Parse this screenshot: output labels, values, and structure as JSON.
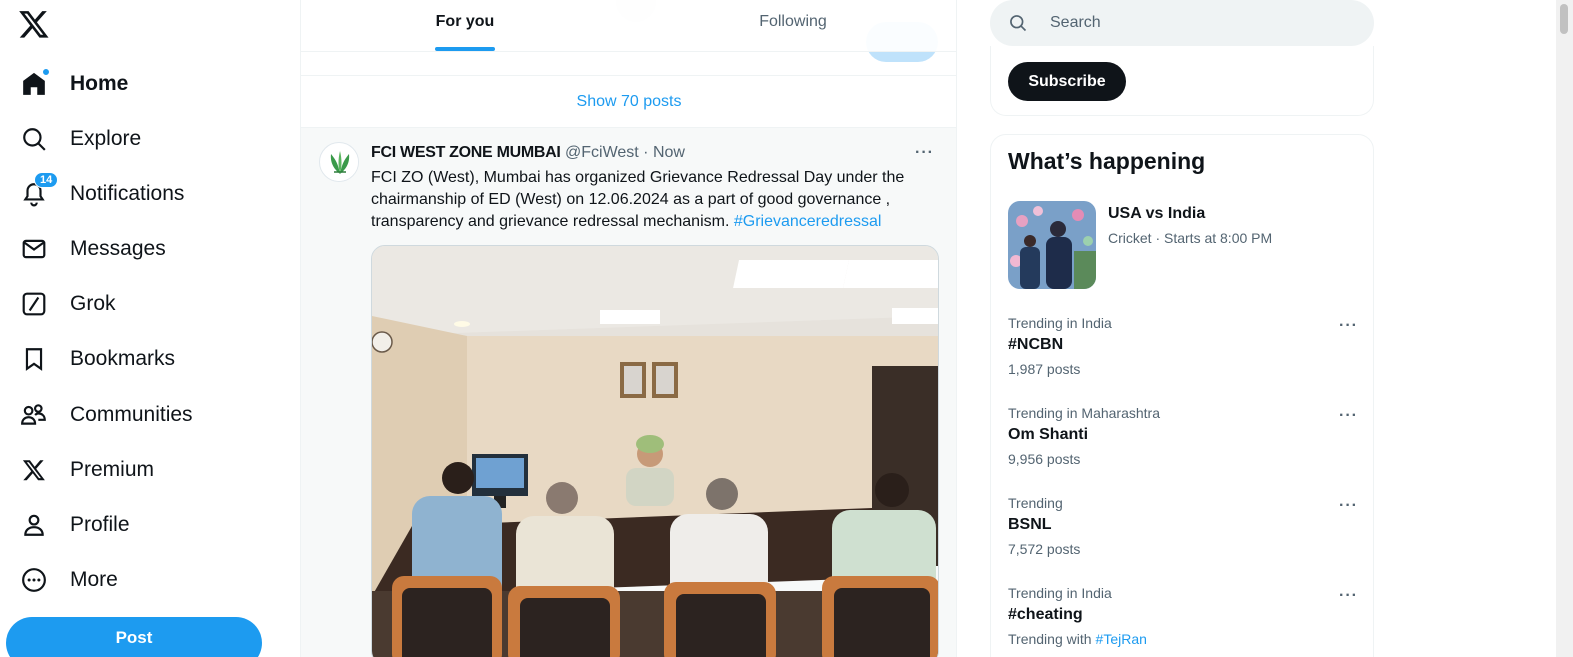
{
  "nav": {
    "items": [
      {
        "label": "Home",
        "icon": "home-icon"
      },
      {
        "label": "Explore",
        "icon": "search-icon"
      },
      {
        "label": "Notifications",
        "icon": "bell-icon",
        "badge": "14"
      },
      {
        "label": "Messages",
        "icon": "mail-icon"
      },
      {
        "label": "Grok",
        "icon": "grok-icon"
      },
      {
        "label": "Bookmarks",
        "icon": "bookmark-icon"
      },
      {
        "label": "Communities",
        "icon": "communities-icon"
      },
      {
        "label": "Premium",
        "icon": "x-logo-icon"
      },
      {
        "label": "Profile",
        "icon": "person-icon"
      },
      {
        "label": "More",
        "icon": "more-circle-icon"
      }
    ],
    "post_label": "Post"
  },
  "tabs": [
    {
      "label": "For you"
    },
    {
      "label": "Following"
    }
  ],
  "feed": {
    "show_posts": "Show 70 posts"
  },
  "tweet": {
    "name": "FCI WEST ZONE MUMBAI",
    "handle": "@FciWest",
    "separator": " · ",
    "time": "Now",
    "text": "FCI ZO (West), Mumbai has organized Grievance Redressal Day under the chairmanship of ED (West) on 12.06.2024 as a part of good governance , transparency and grievance redressal mechanism. ",
    "hashtag": "#Grievanceredressal"
  },
  "search": {
    "placeholder": "Search"
  },
  "subscribe_label": "Subscribe",
  "happening": {
    "title": "What’s happening",
    "featured": {
      "title": "USA vs India",
      "subtitle": "Cricket · Starts at 8:00 PM"
    },
    "trends": [
      {
        "context": "Trending in India",
        "name": "#NCBN",
        "count": "1,987 posts"
      },
      {
        "context": "Trending in Maharashtra",
        "name": "Om Shanti",
        "count": "9,956 posts"
      },
      {
        "context": "Trending",
        "name": "BSNL",
        "count": "7,572 posts"
      },
      {
        "context": "Trending in India",
        "name": "#cheating",
        "count": "Trending with",
        "with_tag": "#TejRan"
      }
    ]
  },
  "colors": {
    "accent": "#1d9bf0",
    "text": "#0f1419",
    "muted": "#536471"
  }
}
